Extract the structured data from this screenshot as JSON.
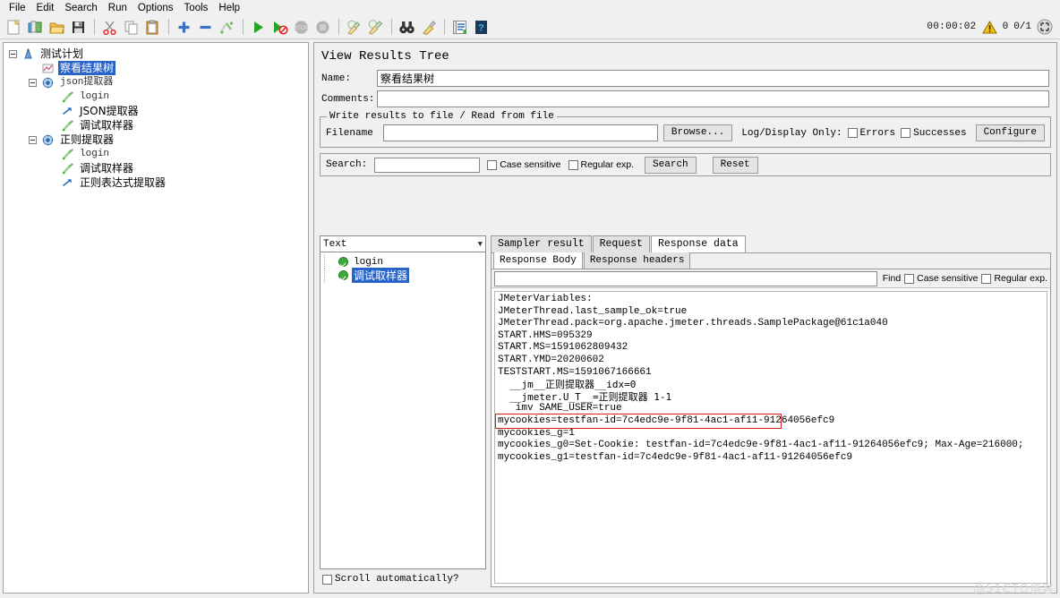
{
  "menubar": {
    "items": [
      {
        "label": "File",
        "name": "menu-file"
      },
      {
        "label": "Edit",
        "name": "menu-edit"
      },
      {
        "label": "Search",
        "name": "menu-search"
      },
      {
        "label": "Run",
        "name": "menu-run"
      },
      {
        "label": "Options",
        "name": "menu-options"
      },
      {
        "label": "Tools",
        "name": "menu-tools"
      },
      {
        "label": "Help",
        "name": "menu-help"
      }
    ]
  },
  "toolbar": {
    "buttons": [
      {
        "icon": "new-file-icon",
        "title": "New"
      },
      {
        "icon": "templates-icon",
        "title": "Templates"
      },
      {
        "icon": "open-folder-icon",
        "title": "Open"
      },
      {
        "icon": "save-icon",
        "title": "Save"
      },
      {
        "icon": "cut-icon",
        "title": "Cut"
      },
      {
        "icon": "copy-icon",
        "title": "Copy"
      },
      {
        "icon": "paste-icon",
        "title": "Paste"
      },
      {
        "icon": "expand-plus-icon",
        "title": "Expand all"
      },
      {
        "icon": "collapse-minus-icon",
        "title": "Collapse all"
      },
      {
        "icon": "toggle-icon",
        "title": "Toggle"
      },
      {
        "icon": "start-play-icon",
        "title": "Start"
      },
      {
        "icon": "start-no-pauses-icon",
        "title": "Start no pauses"
      },
      {
        "icon": "stop-icon",
        "title": "Stop"
      },
      {
        "icon": "shutdown-icon",
        "title": "Shutdown"
      },
      {
        "icon": "clear-broom-icon",
        "title": "Clear"
      },
      {
        "icon": "clear-all-broom-icon",
        "title": "Clear All"
      },
      {
        "icon": "search-binoculars-icon",
        "title": "Search"
      },
      {
        "icon": "reset-search-broom-icon",
        "title": "Reset Search"
      },
      {
        "icon": "function-helper-icon",
        "title": "Function Helper"
      },
      {
        "icon": "help-icon",
        "title": "Help"
      }
    ],
    "status": {
      "clock": "00:00:02",
      "warning_icon": "warning-triangle-icon",
      "warning_count": "0",
      "threads": "0/1",
      "expand_icon": "expand-arrows-icon"
    }
  },
  "tree": {
    "nodes": [
      {
        "label": "测试计划",
        "icon": "test-plan-icon",
        "indent": 0,
        "expander": true,
        "selected": false,
        "mono": false
      },
      {
        "label": "察看结果树",
        "icon": "view-results-tree-icon",
        "indent": 1,
        "expander": false,
        "selected": true,
        "mono": false
      },
      {
        "label": "json提取器",
        "icon": "thread-group-icon",
        "indent": 1,
        "expander": true,
        "selected": false,
        "mono": true
      },
      {
        "label": "login",
        "icon": "sampler-icon",
        "indent": 2,
        "expander": false,
        "selected": false,
        "mono": true
      },
      {
        "label": "JSON提取器",
        "icon": "post-processor-icon",
        "indent": 2,
        "expander": false,
        "selected": false,
        "mono": false
      },
      {
        "label": "调试取样器",
        "icon": "sampler-icon",
        "indent": 2,
        "expander": false,
        "selected": false,
        "mono": false
      },
      {
        "label": "正则提取器",
        "icon": "thread-group-icon",
        "indent": 1,
        "expander": true,
        "selected": false,
        "mono": false
      },
      {
        "label": "login",
        "icon": "sampler-icon",
        "indent": 2,
        "expander": false,
        "selected": false,
        "mono": true
      },
      {
        "label": "调试取样器",
        "icon": "sampler-icon",
        "indent": 2,
        "expander": false,
        "selected": false,
        "mono": false
      },
      {
        "label": "正则表达式提取器",
        "icon": "post-processor-icon",
        "indent": 2,
        "expander": false,
        "selected": false,
        "mono": false
      }
    ]
  },
  "main": {
    "title": "View Results Tree",
    "name_label": "Name:",
    "name_value": "察看结果树",
    "comments_label": "Comments:",
    "comments_value": "",
    "file_group": {
      "legend": "Write results to file / Read from file",
      "filename_label": "Filename",
      "filename_value": "",
      "browse_button": "Browse...",
      "log_display_label": "Log/Display Only:",
      "errors_checkbox": "Errors",
      "successes_checkbox": "Successes",
      "configure_button": "Configure"
    },
    "search_bar": {
      "label": "Search:",
      "value": "",
      "case_sensitive": "Case sensitive",
      "regular_exp": "Regular exp.",
      "search_button": "Search",
      "reset_button": "Reset"
    },
    "renderer": {
      "selected": "Text",
      "caret_icon": "chevron-down-icon"
    },
    "results": [
      {
        "label": "login",
        "icon": "success-check-icon",
        "selected": false,
        "mono": true
      },
      {
        "label": "调试取样器",
        "icon": "success-check-icon",
        "selected": true,
        "mono": false
      }
    ],
    "scroll_automatically": "Scroll automatically?",
    "tabs": [
      {
        "label": "Sampler result",
        "active": false
      },
      {
        "label": "Request",
        "active": false
      },
      {
        "label": "Response data",
        "active": true
      }
    ],
    "subtabs": [
      {
        "label": "Response Body",
        "active": true
      },
      {
        "label": "Response headers",
        "active": false
      }
    ],
    "find_bar": {
      "value": "",
      "find_label": "Find",
      "case_sensitive": "Case sensitive",
      "regular_exp": "Regular exp."
    },
    "response_lines": [
      {
        "text": "JMeterVariables:",
        "cn": false
      },
      {
        "text": "JMeterThread.last_sample_ok=true",
        "cn": false
      },
      {
        "text": "JMeterThread.pack=org.apache.jmeter.threads.SamplePackage@61c1a040",
        "cn": false
      },
      {
        "text": "START.HMS=095329",
        "cn": false
      },
      {
        "text": "START.MS=1591062809432",
        "cn": false
      },
      {
        "text": "START.YMD=20200602",
        "cn": false
      },
      {
        "text": "TESTSTART.MS=1591067166661",
        "cn": false
      },
      {
        "text": "  __jm__正则提取器__idx=0",
        "cn": true
      },
      {
        "text": "  __jmeter.U_T__=正则提取器 1-1",
        "cn": true
      },
      {
        "text": "   imv SAME_USER=true",
        "cn": false
      },
      {
        "text": "mycookies=testfan-id=7c4edc9e-9f81-4ac1-af11-91264056efc9",
        "cn": false
      },
      {
        "text": "mycookies_g=1",
        "cn": false
      },
      {
        "text": "mycookies_g0=Set-Cookie: testfan-id=7c4edc9e-9f81-4ac1-af11-91264056efc9; Max-Age=216000;",
        "cn": false
      },
      {
        "text": "mycookies_g1=testfan-id=7c4edc9e-9f81-4ac1-af11-91264056efc9",
        "cn": false
      }
    ],
    "highlight": {
      "line_index": 10,
      "color": "#e01b1b"
    }
  },
  "watermark": "@51CTO博客",
  "colors": {
    "selection_blue": "#2a63c8",
    "highlight_red": "#e01b1b",
    "panel_bg": "#f0f0f0",
    "field_bg": "#ffffff",
    "success_green": "#3da93d"
  }
}
